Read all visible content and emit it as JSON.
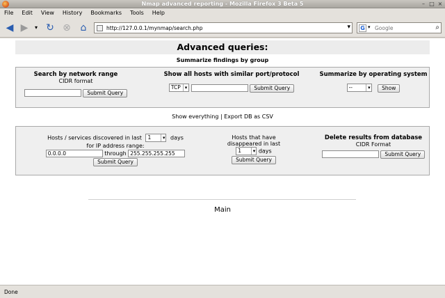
{
  "window": {
    "title": "Nmap advanced reporting - Mozilla Firefox 3 Beta 5"
  },
  "menu": [
    "File",
    "Edit",
    "View",
    "History",
    "Bookmarks",
    "Tools",
    "Help"
  ],
  "nav": {
    "url": "http://127.0.0.1/mynmap/search.php",
    "search_placeholder": "Google",
    "search_engine_letter": "G"
  },
  "page": {
    "heading": "Advanced queries:",
    "subheading": "Summarize findings by group",
    "group": {
      "network": {
        "title": "Search by network range",
        "subtitle": "CIDR format",
        "submit": "Submit Query",
        "value": ""
      },
      "port": {
        "title": "Show all hosts with similar port/protocol",
        "protocol": "TCP",
        "port_value": "",
        "submit": "Submit Query"
      },
      "os": {
        "title": "Summarize by operating system",
        "selected": "--",
        "submit": "Show"
      }
    },
    "links": {
      "show_everything": "Show everything",
      "separator": "|",
      "export": "Export DB as CSV"
    },
    "discovery": {
      "label_pre": "Hosts / services discovered in last",
      "days_value": "1",
      "label_days": "days",
      "label_range": "for IP address range:",
      "ip_from": "0.0.0.0",
      "through": "through",
      "ip_to": "255.255.255.255",
      "submit": "Submit Query"
    },
    "disappeared": {
      "line1": "Hosts that have",
      "line2": "disappeared in last",
      "days_value": "1",
      "label_days": "days",
      "submit": "Submit Query"
    },
    "delete": {
      "title": "Delete results from database",
      "subtitle": "CIDR Format",
      "value": "",
      "submit": "Submit Query"
    },
    "main_link": "Main"
  },
  "status": {
    "text": "Done"
  }
}
